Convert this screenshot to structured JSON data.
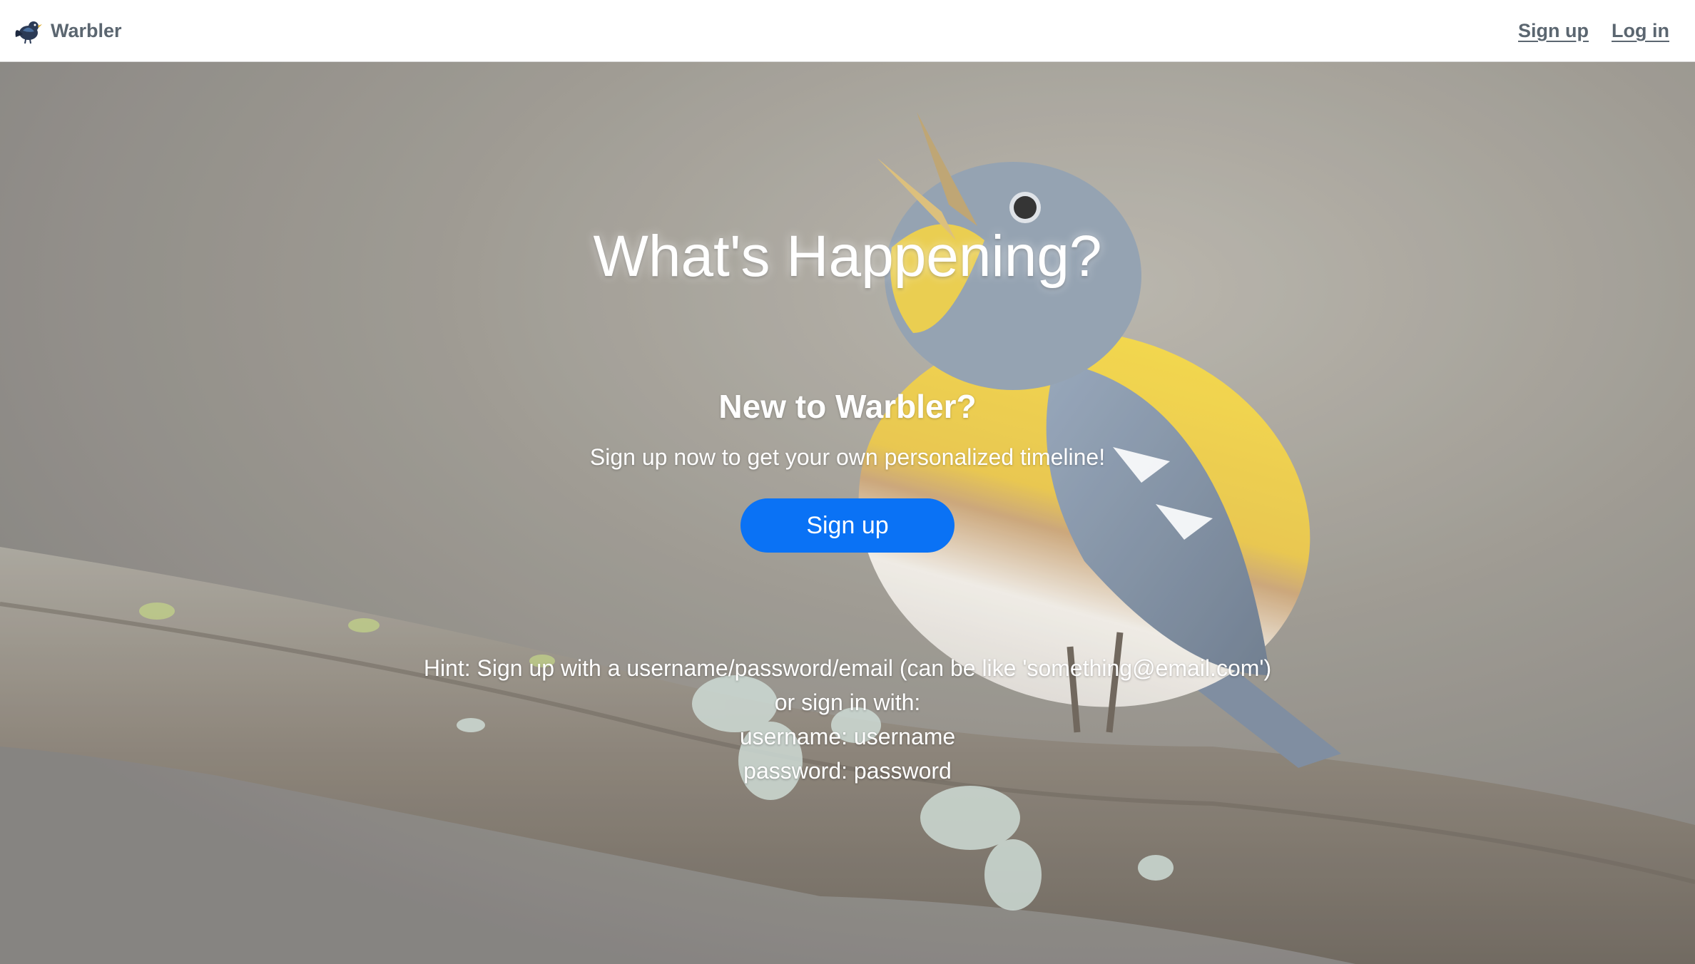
{
  "brand": {
    "name": "Warbler",
    "logo_icon": "bird-logo-icon"
  },
  "nav": {
    "signup_label": "Sign up",
    "login_label": "Log in"
  },
  "hero": {
    "headline": "What's Happening?",
    "subhead": "New to Warbler?",
    "tagline": "Sign up now to get your own personalized timeline!",
    "signup_button_label": "Sign up",
    "hint_lines": [
      "Hint: Sign up with a username/password/email (can be like 'something@email.com')",
      "or sign in with:",
      "username: username",
      "password: password"
    ]
  },
  "colors": {
    "nav_text": "#5b6670",
    "button_bg": "#0a72f5",
    "hero_text": "#ffffff"
  }
}
